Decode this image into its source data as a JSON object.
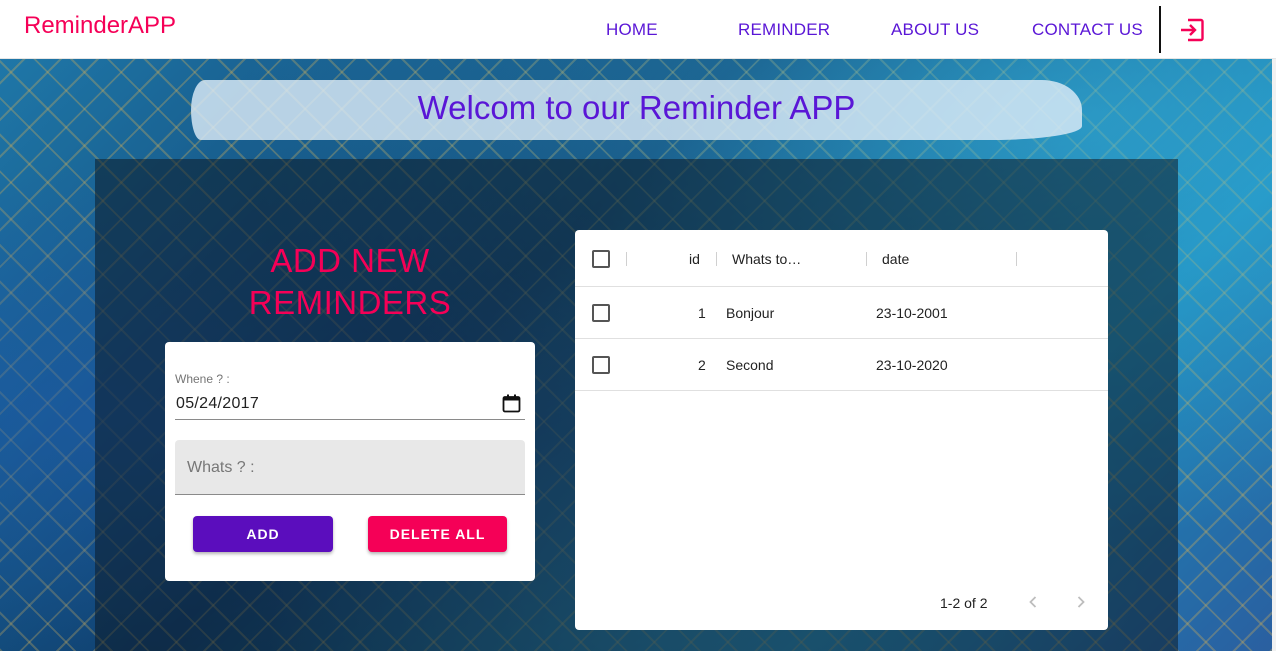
{
  "header": {
    "brand": "ReminderAPP",
    "nav": [
      "HOME",
      "REMINDER",
      "ABOUT US",
      "CONTACT US"
    ]
  },
  "banner": {
    "title": "Welcom to our Reminder APP"
  },
  "form": {
    "title_line1": "ADD NEW",
    "title_line2": "REMINDERS",
    "date_label": "Whene ? :",
    "date_value": "05/24/2017",
    "whats_placeholder": "Whats ? :",
    "add_label": "ADD",
    "delete_label": "DELETE ALL"
  },
  "table": {
    "columns": [
      "id",
      "Whats to…",
      "date"
    ],
    "rows": [
      {
        "id": "1",
        "what": "Bonjour",
        "date": "23-10-2001"
      },
      {
        "id": "2",
        "what": "Second",
        "date": "23-10-2020"
      }
    ],
    "pagination": "1-2 of 2"
  },
  "icons": {
    "logout": "logout-icon",
    "calendar": "calendar-icon",
    "prev": "chevron-left-icon",
    "next": "chevron-right-icon"
  },
  "colors": {
    "brand": "#f50057",
    "primary": "#5b0dbd",
    "nav": "#5a16d6"
  }
}
